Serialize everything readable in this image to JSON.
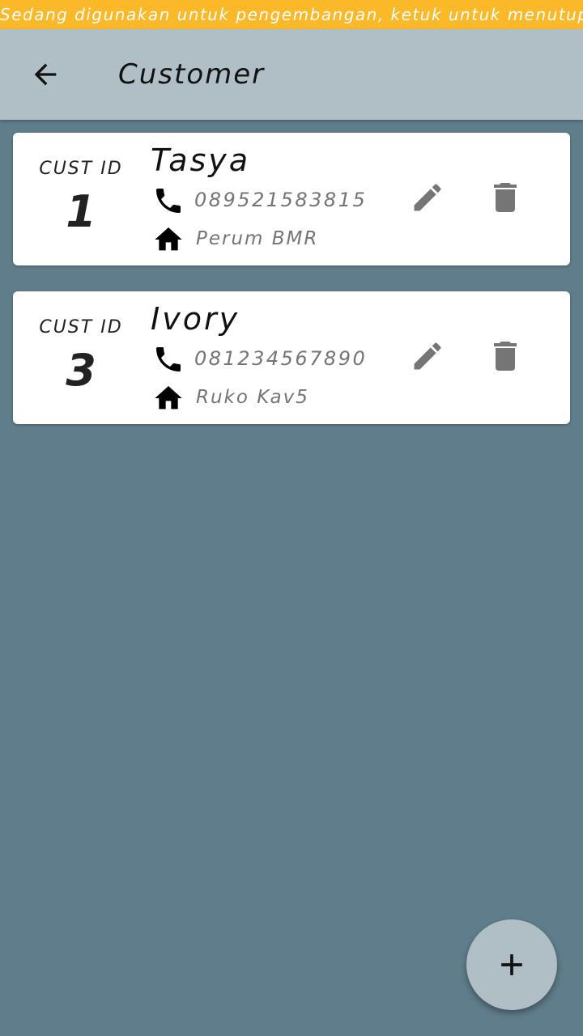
{
  "dev_banner": {
    "text": "Sedang digunakan untuk pengembangan, ketuk untuk menutup"
  },
  "app_bar": {
    "back_icon": "arrow-back-icon",
    "title": "Customer"
  },
  "customers": [
    {
      "id_label": "CUST ID",
      "id": "1",
      "name": "Tasya",
      "phone": "089521583815",
      "address": "Perum BMR"
    },
    {
      "id_label": "CUST ID",
      "id": "3",
      "name": "Ivory",
      "phone": "081234567890",
      "address": "Ruko Kav5"
    }
  ],
  "fab": {
    "icon": "add-icon"
  },
  "colors": {
    "banner": "#fbb829",
    "app_bar": "#b0bec5",
    "background": "#607d8b",
    "card": "#ffffff",
    "action_icons": "#757575"
  }
}
